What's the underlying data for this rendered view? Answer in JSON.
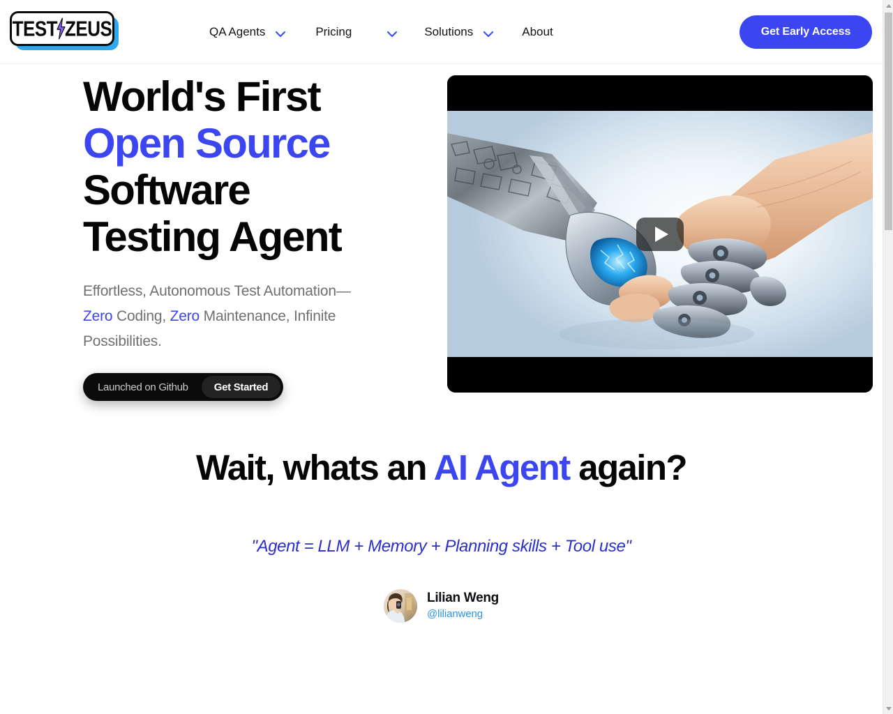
{
  "brand": {
    "logo_text_1": "TEST",
    "logo_text_2": "ZEUS",
    "logo_icon": "lightning-bolt-icon",
    "accent_blue": "#3b46f1",
    "logo_shadow_cyan": "#2ea9f0",
    "quote_blue": "#2b2ecb",
    "handle_blue": "#2b94e8"
  },
  "nav": {
    "items": [
      {
        "label": "QA Agents",
        "has_dropdown": true,
        "icon": "chevron-down-icon"
      },
      {
        "label": "Pricing",
        "has_dropdown": true,
        "icon": "chevron-down-icon"
      },
      {
        "label": "Solutions",
        "has_dropdown": true,
        "icon": "chevron-down-icon"
      },
      {
        "label": "About",
        "has_dropdown": false,
        "icon": ""
      }
    ],
    "cta_label": "Get Early Access"
  },
  "hero": {
    "title_line1": "World's First",
    "title_line2_accent": "Open Source",
    "title_line3": "Software",
    "title_line4": "Testing Agent",
    "sub_part1": "Effortless, Autonomous Test Automation—",
    "sub_accent1": "Zero",
    "sub_part2": " Coding, ",
    "sub_accent2": "Zero",
    "sub_part3": " Maintenance, Infinite Possibilities.",
    "github_badge_label": "Launched on Github",
    "github_badge_button": "Get Started",
    "video": {
      "play_icon": "play-button-icon",
      "alt": "robot hand and human hand shaking with glowing blue energy"
    }
  },
  "agent_section": {
    "heading_part1": "Wait, whats an ",
    "heading_accent": "AI Agent",
    "heading_part2": " again?",
    "quote": "\"Agent = LLM + Memory + Planning skills + Tool use\"",
    "author_name": "Lilian Weng",
    "author_handle": "@lilianweng",
    "avatar_alt": "profile photo of Lilian Weng"
  },
  "scrollbar": {
    "up_icon": "scroll-up-arrow-icon",
    "down_icon": "scroll-down-arrow-icon"
  }
}
